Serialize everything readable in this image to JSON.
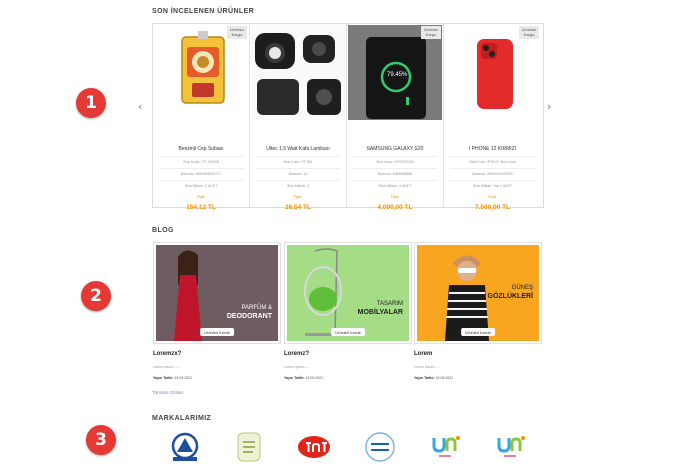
{
  "markers": [
    "1",
    "2",
    "3"
  ],
  "recent": {
    "title": "SON İNCELENEN ÜRÜNLER",
    "prev_icon": "‹",
    "next_icon": "›",
    "products": [
      {
        "badge": "Ücretsiz Kargo",
        "image_icon": "pocket-heater-icon",
        "name": "Benzinli Cep Sobası",
        "code": "Stok Kodu: CP-724008",
        "barcode": "Barkodu: 8469825000717",
        "qty": "Stok Miktarı: 2 ADET",
        "price_label": "Fiyat:",
        "price": "154,12 TL"
      },
      {
        "badge": "",
        "image_icon": "headlamp-icon",
        "name": "Ultec 1,5 Watt Kafa Lambası",
        "code": "Stok Kodu: ST-551",
        "barcode": "Barkodu: 13",
        "qty": "Stok Miktarı: 0",
        "price_label": "Fiyat:",
        "price": "26,54 TL"
      },
      {
        "badge": "Ücretsiz Kargo",
        "image_icon": "tablet-charging-icon",
        "image_text": "79.45%",
        "name": "SAMSUNG GALAXY S20",
        "code": "Stok Kodu: 9702002100",
        "barcode": "Barkodu: 5465488888",
        "qty": "Stok Miktarı: 3 ADET",
        "price_label": "Fiyat:",
        "price": "4.000,00 TL"
      },
      {
        "badge": "Ücretsiz Kargo",
        "image_icon": "red-iphone-icon",
        "name": "I PHONE 12 KIRMIZI",
        "code": "Stok Kodu: IPH022 Stok kodu",
        "barcode": "Barkodu: 6866000000000",
        "qty": "Stok Miktarı: Yok 1 ADET",
        "price_label": "Fiyat:",
        "price": "7.500,00 TL"
      }
    ]
  },
  "blog": {
    "title": "BLOG",
    "more": "Tümünü Göster",
    "posts": [
      {
        "banner_line1": "PARFÜM &",
        "banner_line2": "DEODORANT",
        "button": "Ürünleri İncele",
        "title": "Loremzx?",
        "summary": "Lorem İpsum.......",
        "date_label": "Yayın Tarihi:",
        "date": "15.09.2021",
        "bg": "#6b5a5d",
        "image_icon": "woman-red-dress-icon"
      },
      {
        "banner_line1": "TASARIM",
        "banner_line2": "MOBİLYALAR",
        "button": "Ürünleri İncele",
        "title": "Loremz?",
        "summary": "Lorem İpsum.......",
        "date_label": "Yayın Tarihi:",
        "date": "15.09.2021",
        "bg": "#a2dc84",
        "image_icon": "hanging-chair-icon"
      },
      {
        "banner_line1": "GÜNEŞ",
        "banner_line2": "GÖZLÜKLERİ",
        "button": "Ürünleri İncele",
        "title": "Lorem",
        "summary": "Lorem İpsum.......",
        "date_label": "Yayın Tarihi:",
        "date": "15.06.2021",
        "bg": "#f7a21e",
        "image_icon": "woman-sunglasses-icon"
      }
    ]
  },
  "brands": {
    "title": "MARKALARIMIZ",
    "items": [
      {
        "name": "AKSOFT",
        "icon": "aksoft-logo-icon"
      },
      {
        "name": "Evyap Sabun Fabrikası",
        "icon": "evyap-logo-icon"
      },
      {
        "name": "tat",
        "icon": "tat-logo-icon"
      },
      {
        "name": "Erikli",
        "icon": "erikli-logo-icon"
      },
      {
        "name": "Uni Baby",
        "icon": "unibaby-logo-icon"
      },
      {
        "name": "Uni Baby",
        "icon": "unibaby-logo-icon"
      }
    ]
  },
  "colors": {
    "accent": "#f29100",
    "marker": "#e53935",
    "link": "#5b8cd8"
  }
}
